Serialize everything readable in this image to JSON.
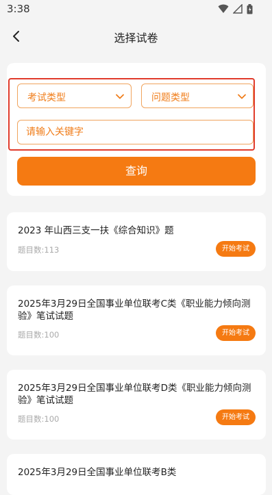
{
  "status": {
    "time": "3:38"
  },
  "header": {
    "title": "选择试卷"
  },
  "filters": {
    "exam_type_label": "考试类型",
    "question_type_label": "问题类型",
    "search_placeholder": "请输入关键字",
    "search_value": "",
    "query_label": "查询"
  },
  "exams": [
    {
      "title": "2023 年山西三支一扶《综合知识》题",
      "count": "题目数:113",
      "start_label": "开始考试"
    },
    {
      "title": "2025年3月29日全国事业单位联考C类《职业能力倾向测验》笔试试题",
      "count": "题目数:100",
      "start_label": "开始考试"
    },
    {
      "title": "2025年3月29日全国事业单位联考D类《职业能力倾向测验》笔试试题",
      "count": "题目数:100",
      "start_label": "开始考试"
    },
    {
      "title": "2025年3月29日全国事业单位联考B类",
      "count": "",
      "start_label": ""
    }
  ],
  "colors": {
    "accent": "#f57a12",
    "highlight_border": "#e03a2a",
    "background": "#f4f4f4"
  }
}
